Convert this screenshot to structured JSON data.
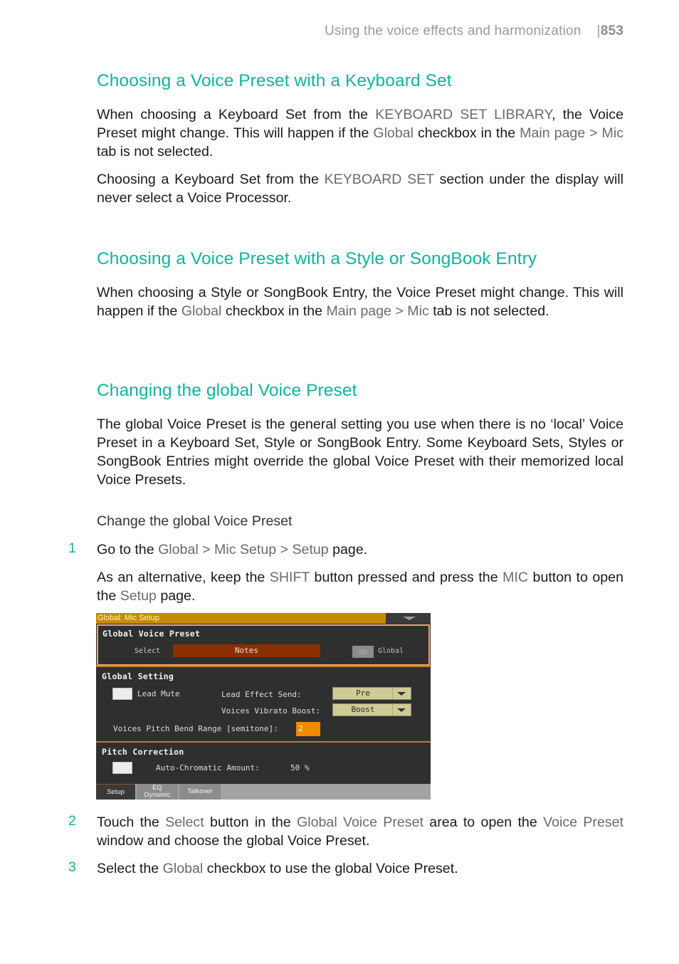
{
  "header": {
    "chapter_title": "Using the voice effects and harmonization",
    "separator": "|",
    "page_number": "853"
  },
  "colors": {
    "heading": "#11b39a",
    "ui_reference": "#6a6a6a",
    "body": "#1a1a1a"
  },
  "sections": [
    {
      "heading": "Choosing a Voice Preset with a Keyboard Set",
      "paragraphs": [
        {
          "t1": "When choosing a Keyboard Set from the ",
          "u1": "KEYBOARD SET LIBRARY",
          "t2": ", the Voice Preset might change. This will happen if the ",
          "u2": "Global",
          "t3": " checkbox in the ",
          "u3": "Main page > Mic",
          "t4": " tab is not selected."
        },
        {
          "t1": "Choosing a Keyboard Set from the ",
          "u1": "KEYBOARD SET",
          "t2": " section under the dis­play will never select a Voice Processor."
        }
      ]
    },
    {
      "heading": "Choosing a Voice Preset with a Style or SongBook Entry",
      "paragraphs": [
        {
          "t1": "When choosing a Style or SongBook Entry, the Voice Preset might change. This will happen if the ",
          "u1": "Global",
          "t2": " checkbox in the ",
          "u2": "Main page > Mic",
          "t3": " tab is not selected."
        }
      ]
    },
    {
      "heading": "Changing the global Voice Preset",
      "paragraphs": [
        {
          "t1": "The global Voice Preset is the general setting you use when there is no ‘local’ Voice Preset in a Keyboard Set, Style or SongBook Entry. Some Keyboard Sets, Styles or SongBook Entries might override the global Voice Preset with their memorized local Voice Presets."
        }
      ],
      "procedure_title": "Change the global Voice Preset",
      "steps": [
        {
          "number": "1",
          "t1": "Go to the ",
          "u1": "Global > Mic Setup > Setup",
          "t2": " page.",
          "note": {
            "t1": "As an alternative, keep the ",
            "u1": "SHIFT",
            "t2": " button pressed and press the ",
            "u2": "MIC",
            "t3": " button to open the ",
            "u3": "Setup",
            "t4": " page."
          }
        },
        {
          "number": "2",
          "t1": "Touch the ",
          "u1": "Select",
          "t2": " button in the ",
          "u2": "Global Voice Preset",
          "t3": " area to open the ",
          "u3": "Voice Preset",
          "t4": " window and choose the global Voice Preset."
        },
        {
          "number": "3",
          "t1": "Select the ",
          "u1": "Global",
          "t2": " checkbox to use the global Voice Preset."
        }
      ]
    }
  ],
  "screen": {
    "title": "Global: Mic Setup",
    "global_voice_preset": {
      "title": "Global Voice Preset",
      "select_label": "Select",
      "select_value": "Notes",
      "global_checkbox_label": "Global",
      "global_checked": false
    },
    "global_setting": {
      "title": "Global Setting",
      "lead_mute_label": "Lead Mute",
      "lead_mute_checked": false,
      "lead_effect_send_label": "Lead Effect Send:",
      "lead_effect_send_value": "Pre",
      "vibrato_boost_label": "Voices Vibrato Boost:",
      "vibrato_boost_value": "Boost",
      "pitch_bend_label": "Voices Pitch Bend Range [semitone]:",
      "pitch_bend_value": "2"
    },
    "pitch_correction": {
      "title": "Pitch Correction",
      "checked": false,
      "amount_label": "Auto-Chromatic Amount:",
      "amount_value": "50 %"
    },
    "tabs": [
      {
        "line1": "Setup",
        "active": true
      },
      {
        "line1": "EQ",
        "line2": "Dynamic",
        "active": false
      },
      {
        "line1": "Talkover",
        "active": false
      }
    ]
  }
}
